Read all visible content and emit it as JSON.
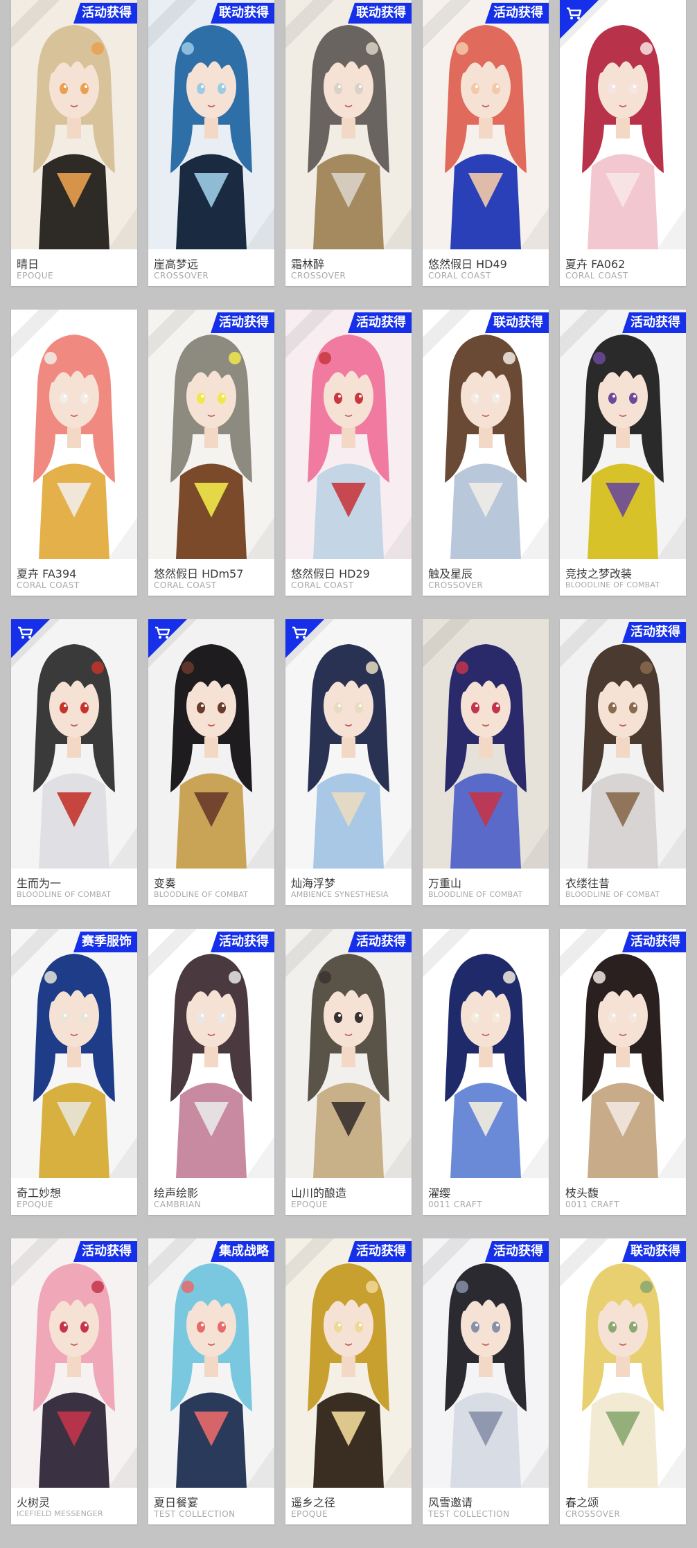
{
  "colors": {
    "badge": "#1530e8",
    "page_bg": "#c4c4c4"
  },
  "cards": [
    {
      "name": "晴日",
      "brand": "EPOQUE",
      "badge": "活动获得",
      "store": false,
      "palette": [
        "#d8c29a",
        "#2e2a26",
        "#e9a050",
        "#f3ece2"
      ]
    },
    {
      "name": "崖高梦远",
      "brand": "CROSSOVER",
      "badge": "联动获得",
      "store": false,
      "palette": [
        "#2e6fa8",
        "#1a2a40",
        "#9ccbe6",
        "#e8eef3"
      ]
    },
    {
      "name": "霜林醉",
      "brand": "CROSSOVER",
      "badge": "联动获得",
      "store": false,
      "palette": [
        "#6a6460",
        "#a58a60",
        "#d9d2c7",
        "#f1ece4"
      ]
    },
    {
      "name": "悠然假日 HD49",
      "brand": "CORAL COAST",
      "badge": "活动获得",
      "store": false,
      "palette": [
        "#e06a5c",
        "#2a40b8",
        "#f3c9a8",
        "#f6f1ec"
      ]
    },
    {
      "name": "夏卉 FA062",
      "brand": "CORAL COAST",
      "badge": "",
      "store": true,
      "palette": [
        "#b8334a",
        "#f2c7cf",
        "#f7e5e5",
        "#ffffff"
      ]
    },
    {
      "name": "夏卉 FA394",
      "brand": "CORAL COAST",
      "badge": "",
      "store": false,
      "palette": [
        "#f08a80",
        "#e4b04a",
        "#f2ede8",
        "#ffffff"
      ]
    },
    {
      "name": "悠然假日 HDm57",
      "brand": "CORAL COAST",
      "badge": "活动获得",
      "store": false,
      "palette": [
        "#8d8a80",
        "#7a4a2a",
        "#f0e84a",
        "#f5f3ef"
      ]
    },
    {
      "name": "悠然假日 HD29",
      "brand": "CORAL COAST",
      "badge": "活动获得",
      "store": false,
      "palette": [
        "#f07aa0",
        "#c4d6e6",
        "#c8383e",
        "#f8eef2"
      ]
    },
    {
      "name": "触及星辰",
      "brand": "CROSSOVER",
      "badge": "联动获得",
      "store": false,
      "palette": [
        "#6a4a34",
        "#b8c8da",
        "#f1ece6",
        "#ffffff"
      ]
    },
    {
      "name": "竞技之梦改装",
      "brand": "BLOODLINE OF COMBAT",
      "badge": "活动获得",
      "store": false,
      "palette": [
        "#2a2a2a",
        "#d8c22a",
        "#6c4a9a",
        "#f4f4f4"
      ]
    },
    {
      "name": "生而为一",
      "brand": "BLOODLINE OF COMBAT",
      "badge": "",
      "store": true,
      "palette": [
        "#3a3a3a",
        "#e0e0e4",
        "#c4342c",
        "#f4f4f4"
      ]
    },
    {
      "name": "变奏",
      "brand": "BLOODLINE OF COMBAT",
      "badge": "",
      "store": true,
      "palette": [
        "#1e1c1e",
        "#c9a456",
        "#6a3a2a",
        "#f2f2f2"
      ]
    },
    {
      "name": "灿海浮梦",
      "brand": "AMBIENCE SYNESTHESIA",
      "badge": "",
      "store": true,
      "palette": [
        "#2a3254",
        "#a8c8e6",
        "#e8dcc0",
        "#f6f6f6"
      ]
    },
    {
      "name": "万重山",
      "brand": "BLOODLINE OF COMBAT",
      "badge": "",
      "store": false,
      "palette": [
        "#2a2a6a",
        "#5a6ac8",
        "#c4344a",
        "#e6e2da"
      ]
    },
    {
      "name": "衣缕往昔",
      "brand": "BLOODLINE OF COMBAT",
      "badge": "活动获得",
      "store": false,
      "palette": [
        "#4a3a30",
        "#d8d4d4",
        "#8a6a4e",
        "#f2f2f2"
      ]
    },
    {
      "name": "奇工妙想",
      "brand": "EPOQUE",
      "badge": "赛季服饰",
      "store": false,
      "palette": [
        "#1e3c88",
        "#d8b040",
        "#e8e4d8",
        "#f6f6f6"
      ]
    },
    {
      "name": "绘声绘影",
      "brand": "CAMBRIAN",
      "badge": "活动获得",
      "store": false,
      "palette": [
        "#4a3a40",
        "#c88aa0",
        "#e8e8e8",
        "#ffffff"
      ]
    },
    {
      "name": "山川的酿造",
      "brand": "EPOQUE",
      "badge": "活动获得",
      "store": false,
      "palette": [
        "#5a5448",
        "#c8b088",
        "#3a3230",
        "#f2f0ec"
      ]
    },
    {
      "name": "濯缨",
      "brand": "0011 CRAFT",
      "badge": "",
      "store": false,
      "palette": [
        "#1e2a6a",
        "#6a8ad8",
        "#f2ecde",
        "#ffffff"
      ]
    },
    {
      "name": "枝头馥",
      "brand": "0011 CRAFT",
      "badge": "活动获得",
      "store": false,
      "palette": [
        "#2a2020",
        "#c8ac8a",
        "#f2e8e0",
        "#ffffff"
      ]
    },
    {
      "name": "火树灵",
      "brand": "ICEFIELD MESSENGER",
      "badge": "活动获得",
      "store": false,
      "palette": [
        "#f0a8b8",
        "#3a3242",
        "#c4344a",
        "#f6f2f2"
      ]
    },
    {
      "name": "夏日餐宴",
      "brand": "TEST COLLECTION",
      "badge": "集成战略",
      "store": false,
      "palette": [
        "#7ac8e0",
        "#2a3a5a",
        "#e86a6a",
        "#f4f4f4"
      ]
    },
    {
      "name": "遥乡之径",
      "brand": "EPOQUE",
      "badge": "活动获得",
      "store": false,
      "palette": [
        "#c8a030",
        "#3a2e22",
        "#f0d898",
        "#f4f0e6"
      ]
    },
    {
      "name": "风雪邀请",
      "brand": "TEST COLLECTION",
      "badge": "活动获得",
      "store": false,
      "palette": [
        "#2a2a30",
        "#d8dce4",
        "#8890a8",
        "#f4f4f6"
      ]
    },
    {
      "name": "春之颂",
      "brand": "CROSSOVER",
      "badge": "联动获得",
      "store": false,
      "palette": [
        "#e8d070",
        "#f2ead2",
        "#8aa870",
        "#ffffff"
      ]
    }
  ]
}
